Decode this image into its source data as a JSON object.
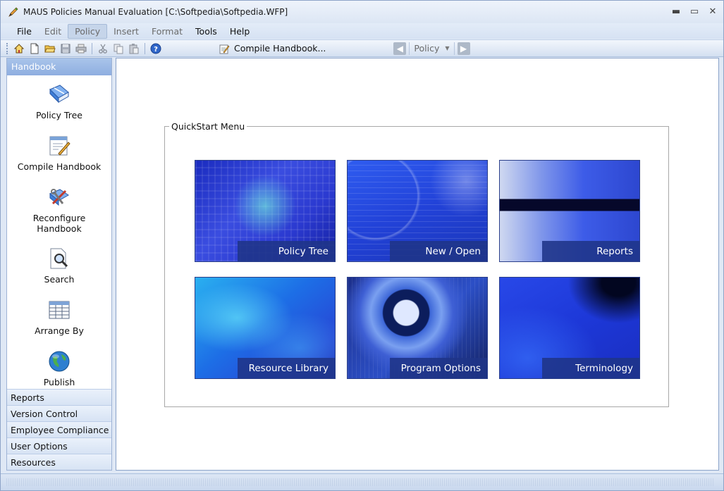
{
  "window": {
    "title": "MAUS Policies Manual Evaluation [C:\\Softpedia\\Softpedia.WFP]",
    "min_glyph": "▬",
    "max_glyph": "▭",
    "close_glyph": "✕"
  },
  "menu": {
    "items": [
      {
        "label": "File",
        "state": "enabled"
      },
      {
        "label": "Edit",
        "state": "disabled"
      },
      {
        "label": "Policy",
        "state": "active"
      },
      {
        "label": "Insert",
        "state": "disabled"
      },
      {
        "label": "Format",
        "state": "disabled"
      },
      {
        "label": "Tools",
        "state": "enabled"
      },
      {
        "label": "Help",
        "state": "enabled"
      }
    ]
  },
  "toolbar": {
    "compile_label": "Compile Handbook...",
    "nav_combo_label": "Policy",
    "nav_back_glyph": "◀",
    "nav_forward_glyph": "▶"
  },
  "sidebar": {
    "header": "Handbook",
    "tools": [
      {
        "label": "Policy Tree",
        "icon": "book-icon"
      },
      {
        "label": "Compile Handbook",
        "icon": "compile-icon"
      },
      {
        "label": "Reconfigure Handbook",
        "icon": "reconfigure-icon"
      },
      {
        "label": "Search",
        "icon": "search-icon"
      },
      {
        "label": "Arrange By",
        "icon": "arrange-icon"
      },
      {
        "label": "Publish",
        "icon": "globe-icon"
      }
    ],
    "sections": [
      "Reports",
      "Version Control",
      "Employee Compliance",
      "User Options",
      "Resources"
    ]
  },
  "quickstart": {
    "legend": "QuickStart Menu",
    "tiles": [
      "Policy Tree",
      "New / Open",
      "Reports",
      "Resource Library",
      "Program Options",
      "Terminology"
    ]
  }
}
